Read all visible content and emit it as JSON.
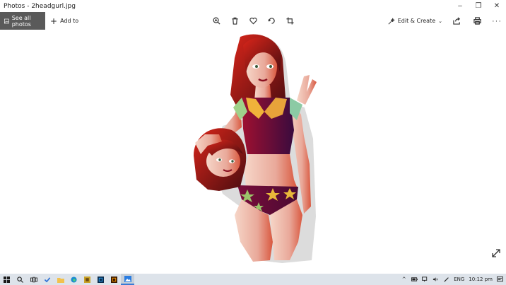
{
  "window": {
    "title": "Photos - 2headgurl.jpg",
    "controls": {
      "minimize": "–",
      "restore": "❐",
      "close": "✕"
    }
  },
  "toolbar": {
    "see_all_label": "See all photos",
    "add_to_label": "Add to",
    "edit_create_label": "Edit & Create",
    "more_label": "···",
    "center_icons": [
      "zoom-icon",
      "delete-icon",
      "favorite-icon",
      "rotate-icon",
      "crop-icon"
    ],
    "right_icons": [
      "share-icon",
      "print-icon"
    ]
  },
  "taskbar": {
    "apps": [
      "start-icon",
      "search-icon",
      "task-view-icon",
      "todo-icon",
      "file-explorer-icon",
      "edge-icon",
      "app-icon",
      "photoshop-icon",
      "illustrator-icon",
      "photos-icon"
    ],
    "tray": {
      "language": "ENG",
      "time": "10:12 pm"
    }
  },
  "colors": {
    "accent": "#3a7bd5",
    "see_all_bg": "#5a5a5a",
    "taskbar_bg": "#dde3ea"
  }
}
